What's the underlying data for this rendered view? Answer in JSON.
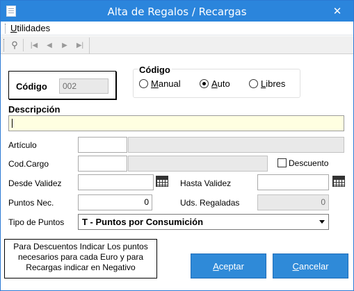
{
  "window": {
    "title": "Alta de Regalos / Recargas",
    "close_glyph": "✕"
  },
  "menu": {
    "items": [
      {
        "label_underlined": "U",
        "label_rest": "tilidades"
      }
    ]
  },
  "toolbar": {
    "buttons": [
      {
        "icon": "binoculars-icon",
        "glyph": "⚲"
      },
      {
        "icon": "first-record-icon",
        "glyph": "|◀"
      },
      {
        "icon": "previous-record-icon",
        "glyph": "◀"
      },
      {
        "icon": "next-record-icon",
        "glyph": "▶"
      },
      {
        "icon": "last-record-icon",
        "glyph": "▶|"
      }
    ]
  },
  "codigo": {
    "label": "Código",
    "value": "002"
  },
  "codigo_group": {
    "label": "Código",
    "options": [
      {
        "underlined": "M",
        "rest": "anual",
        "selected": false
      },
      {
        "underlined": "A",
        "rest": "uto",
        "selected": true
      },
      {
        "underlined": "L",
        "rest": "ibres",
        "selected": false
      }
    ]
  },
  "descripcion": {
    "label": "Descripción",
    "value": "",
    "background": "#ffffe1"
  },
  "articulo": {
    "label": "Artículo",
    "code": "",
    "name": ""
  },
  "cod_cargo": {
    "label": "Cod.Cargo",
    "code": "",
    "name": ""
  },
  "descuento": {
    "label": "Descuento",
    "checked": false
  },
  "desde_validez": {
    "label": "Desde Validez",
    "value": ""
  },
  "hasta_validez": {
    "label": "Hasta Validez",
    "value": ""
  },
  "puntos_nec": {
    "label": "Puntos Nec.",
    "value": "0"
  },
  "uds_regaladas": {
    "label": "Uds. Regaladas",
    "value": "0"
  },
  "tipo_puntos": {
    "label": "Tipo de Puntos",
    "selected": "T - Puntos por Consumición"
  },
  "note": {
    "line1": "Para Descuentos Indicar Los puntos",
    "line2": "necesarios para cada Euro y para",
    "line3": "Recargas indicar en Negativo"
  },
  "buttons": {
    "accept": {
      "underlined": "A",
      "rest": "ceptar"
    },
    "cancel": {
      "underlined": "C",
      "rest": "ancelar"
    }
  },
  "colors": {
    "titlebar": "#2b85dc",
    "button": "#2f8ad8"
  }
}
